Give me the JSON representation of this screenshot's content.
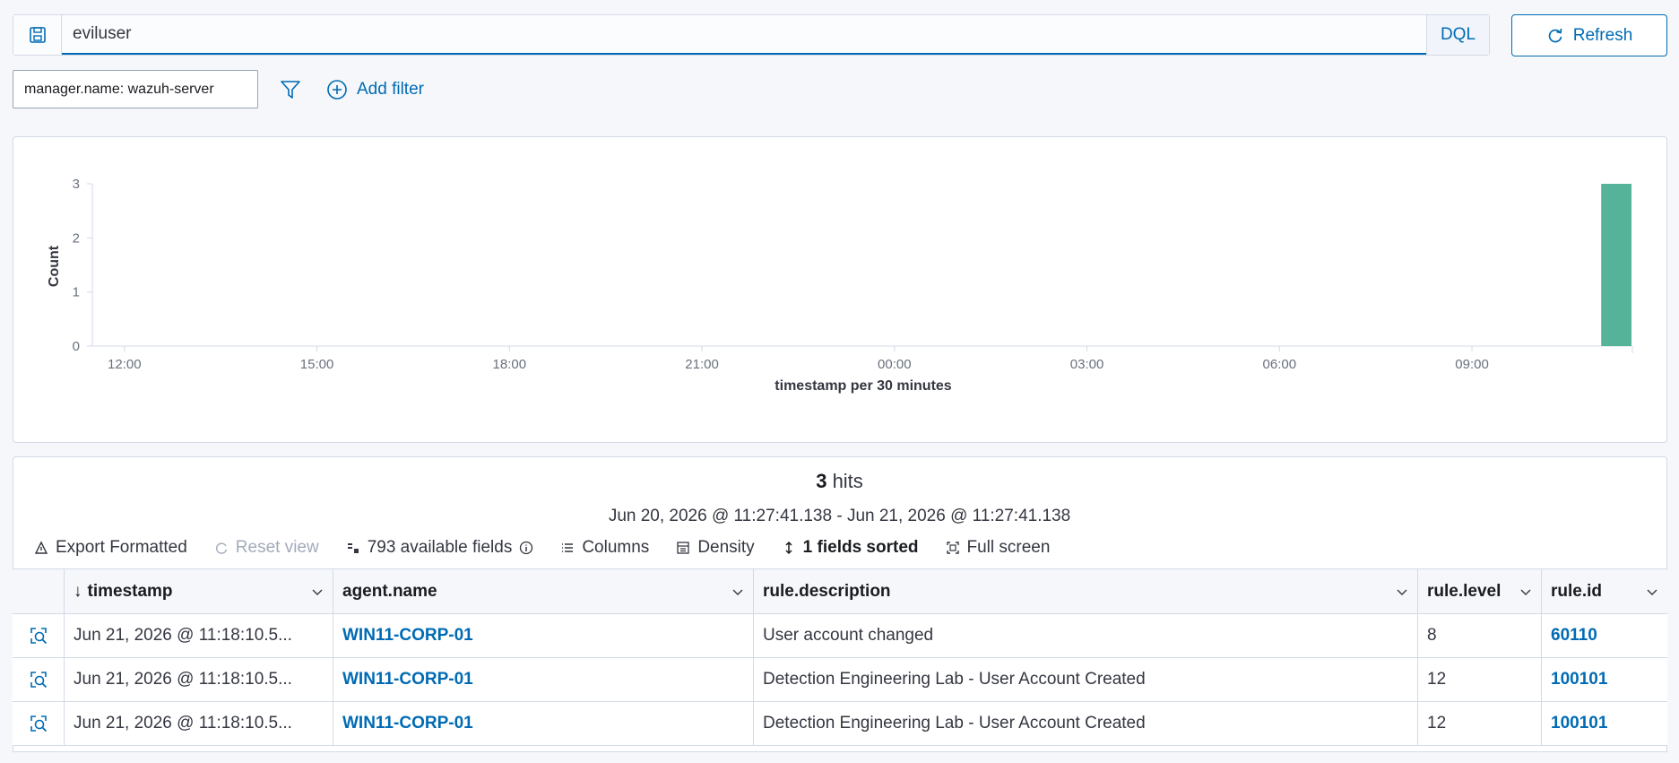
{
  "query": {
    "value": "eviluser",
    "language": "DQL",
    "refresh_label": "Refresh"
  },
  "filters": {
    "active": [
      "manager.name: wazuh-server"
    ],
    "add_filter_label": "Add filter"
  },
  "histogram": {
    "y_label": "Count",
    "x_label": "timestamp per 30 minutes",
    "bar_color": "#54b399"
  },
  "chart_data": {
    "type": "bar",
    "xlabel": "timestamp per 30 minutes",
    "ylabel": "Count",
    "ylim": [
      0,
      3
    ],
    "yticks": [
      0,
      1,
      2,
      3
    ],
    "xticks": [
      "12:00",
      "15:00",
      "18:00",
      "21:00",
      "00:00",
      "03:00",
      "06:00",
      "09:00"
    ],
    "x_range_hours": [
      11.5,
      35.5
    ],
    "bars": [
      {
        "x_hour": 35.0,
        "value": 3
      }
    ],
    "grid": false,
    "color": "#54b399"
  },
  "results": {
    "hit_count": "3",
    "hit_label": "hits",
    "range": "Jun 20, 2026 @ 11:27:41.138 - Jun 21, 2026 @ 11:27:41.138",
    "toolbar": {
      "export": "Export Formatted",
      "reset": "Reset view",
      "fields": "793 available fields",
      "columns": "Columns",
      "density": "Density",
      "sorted": "1 fields sorted",
      "fullscreen": "Full screen"
    },
    "columns": [
      "timestamp",
      "agent.name",
      "rule.description",
      "rule.level",
      "rule.id"
    ],
    "rows": [
      {
        "timestamp": "Jun 21, 2026 @ 11:18:10.5...",
        "agent": "WIN11-CORP-01",
        "description": "User account changed",
        "level": "8",
        "id": "60110"
      },
      {
        "timestamp": "Jun 21, 2026 @ 11:18:10.5...",
        "agent": "WIN11-CORP-01",
        "description": "Detection Engineering Lab - User Account Created",
        "level": "12",
        "id": "100101"
      },
      {
        "timestamp": "Jun 21, 2026 @ 11:18:10.5...",
        "agent": "WIN11-CORP-01",
        "description": "Detection Engineering Lab - User Account Created",
        "level": "12",
        "id": "100101"
      }
    ]
  }
}
